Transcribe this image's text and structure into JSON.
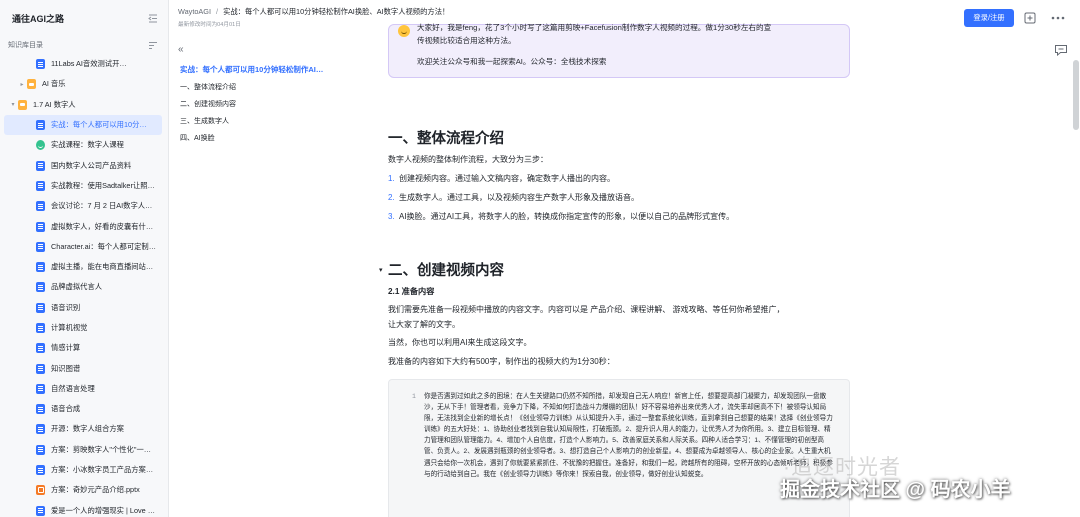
{
  "sidebar": {
    "title": "通往AGI之路",
    "section_label": "知识库目录",
    "items": [
      {
        "label": "11Labs AI音效测试开…",
        "icon": "doc",
        "indent": 2,
        "caret": ""
      },
      {
        "label": "AI 音乐",
        "icon": "folder",
        "indent": 1,
        "caret": "▸"
      },
      {
        "label": "1.7 AI 数字人",
        "icon": "folder",
        "indent": 0,
        "caret": "▾"
      },
      {
        "label": "实战：每个人都可以用10分…",
        "icon": "doc",
        "indent": 2,
        "caret": "",
        "active": true
      },
      {
        "label": "实战课程：数字人课程",
        "icon": "emoji",
        "indent": 2,
        "caret": ""
      },
      {
        "label": "国内数字人公司产品资料",
        "icon": "doc",
        "indent": 2,
        "caret": ""
      },
      {
        "label": "实战教程：使用Sadtalker让照…",
        "icon": "doc",
        "indent": 2,
        "caret": ""
      },
      {
        "label": "会议讨论：7 月 2 日AI数字人…",
        "icon": "doc",
        "indent": 2,
        "caret": ""
      },
      {
        "label": "虚拟数字人，好看的皮囊有什…",
        "icon": "doc",
        "indent": 2,
        "caret": ""
      },
      {
        "label": "Character.ai：每个人都可定制…",
        "icon": "doc",
        "indent": 2,
        "caret": ""
      },
      {
        "label": "虚拟主播，能在电商直播间站…",
        "icon": "doc",
        "indent": 2,
        "caret": ""
      },
      {
        "label": "品牌虚拟代言人",
        "icon": "doc",
        "indent": 2,
        "caret": ""
      },
      {
        "label": "语音识别",
        "icon": "doc",
        "indent": 2,
        "caret": ""
      },
      {
        "label": "计算机视觉",
        "icon": "doc",
        "indent": 2,
        "caret": ""
      },
      {
        "label": "情感计算",
        "icon": "doc",
        "indent": 2,
        "caret": ""
      },
      {
        "label": "知识图谱",
        "icon": "doc",
        "indent": 2,
        "caret": ""
      },
      {
        "label": "自然语言处理",
        "icon": "doc",
        "indent": 2,
        "caret": ""
      },
      {
        "label": "语音合成",
        "icon": "doc",
        "indent": 2,
        "caret": ""
      },
      {
        "label": "开源：数字人组合方案",
        "icon": "doc",
        "indent": 2,
        "caret": ""
      },
      {
        "label": "方案：剪映数字人\"个性化\"一…",
        "icon": "doc",
        "indent": 2,
        "caret": ""
      },
      {
        "label": "方案：小冰数字员工产品方案…",
        "icon": "doc",
        "indent": 2,
        "caret": ""
      },
      {
        "label": "方案：奇妙元产品介绍.pptx",
        "icon": "ppt",
        "indent": 2,
        "caret": ""
      },
      {
        "label": "爱是一个人的增强现实 | Love …",
        "icon": "doc",
        "indent": 2,
        "caret": ""
      }
    ]
  },
  "header": {
    "site": "WaytoAGI",
    "separator": "/",
    "page_title": "实战：每个人都可以用10分钟轻松制作AI换脸、AI数字人视频的方法！",
    "last_modified": "最新修改时间为04月01日",
    "login_label": "登录/注册"
  },
  "toc": {
    "title": "实战：每个人都可以用10分钟轻松制作AI…",
    "items": [
      "一、整体流程介绍",
      "二、创建视频内容",
      "三、生成数字人",
      "四、AI换脸"
    ]
  },
  "callout": {
    "line1": "大家好，我是feng，花了3个小时写了这篇用剪映+Facefusion制作数字人视频的过程。做1分30秒左右的宣",
    "line2": "传视频比较适合用这种方法。",
    "line3": "欢迎关注公众号和我一起探索AI。公众号：全栈技术探索"
  },
  "section1": {
    "heading": "一、整体流程介绍",
    "intro": "数字人视频的整体制作流程，大致分为三步：",
    "steps": [
      "创建视频内容。通过输入文稿内容，确定数字人播出的内容。",
      "生成数字人。通过工具，以及视频内容生产数字人形象及播放语音。",
      "AI换脸。通过AI工具，将数字人的脸，转换成你指定宣传的形象，以便以自己的品牌形式宣传。"
    ]
  },
  "section2": {
    "heading": "二、创建视频内容",
    "sub_heading": "2.1 准备内容",
    "p1_line1": "我们需要先准备一段视频中播放的内容文字。内容可以是 产品介绍、课程讲解、 游戏攻略、等任何你希望推广，",
    "p1_line2": "让大家了解的文字。",
    "p2": "当然，你也可以利用AI来生成这段文字。",
    "p3": "我准备的内容如下大约有500字，制作出的视频大约为1分30秒：",
    "code_line_number": "1",
    "code_text": "你是否遇到过如此之多的困境：在人生关键路口仍然不知所措，却发现自己无人响应！新官上任，想要提高部门凝聚力，却发现团队一盘散沙，无从下手！管理者看，竞争力下降，不知如何打造战斗力爆棚的团队！好不容易培养出来优秀人才，流失率却居高不下！被领导认知局限，无法找到企业新的增长点！《创业领导力训练》从认知提升入手，通过一整套系统化训练，直到拿到自己想要的结果！选择《创业领导力训练》的五大好处：1、协助创业者找到自我认知局限性，打破瓶颈。2、提升识人用人的能力，让优秀人才为你所用。3、建立目标管理、精力管理和团队管理能力。4、增加个人自信度，打造个人影响力。5、改善家庭关系和人际关系。四种人适合学习：1、不懂管理的初创型高管、负责人。2、发展遇到瓶颈的创业领导者。3、想打造自己个人影响力的创业新星。4、想要成为卓越领导人、核心的企业家。人生重大机遇只会给你一次机会，遇到了你就要紧紧抓住、不犹豫的把握住。准备好，和我们一起，跨越所有的阻碍，空杯开放的心态倾听老师，积极参与的行动给到自己。我在《创业领导力训练》等你来！探索自我，创业领导，做好创业认知蜕变。"
  },
  "watermark": {
    "line1": "掘金技术社区 @ 码农小羊",
    "line2": "·追逐时光者"
  },
  "colors": {
    "accent": "#3370ff",
    "callout_bg": "#f2eefc",
    "sidebar_bg": "#f7f8fa",
    "active_item_bg": "#e1eaff"
  },
  "icons": {
    "collapse_sidebar": "collapse-sidebar-icon",
    "sort": "sort-icon",
    "share": "share-icon",
    "more": "more-icon",
    "comment": "comment-icon",
    "toc_collapse": "double-chevron-left-icon"
  }
}
